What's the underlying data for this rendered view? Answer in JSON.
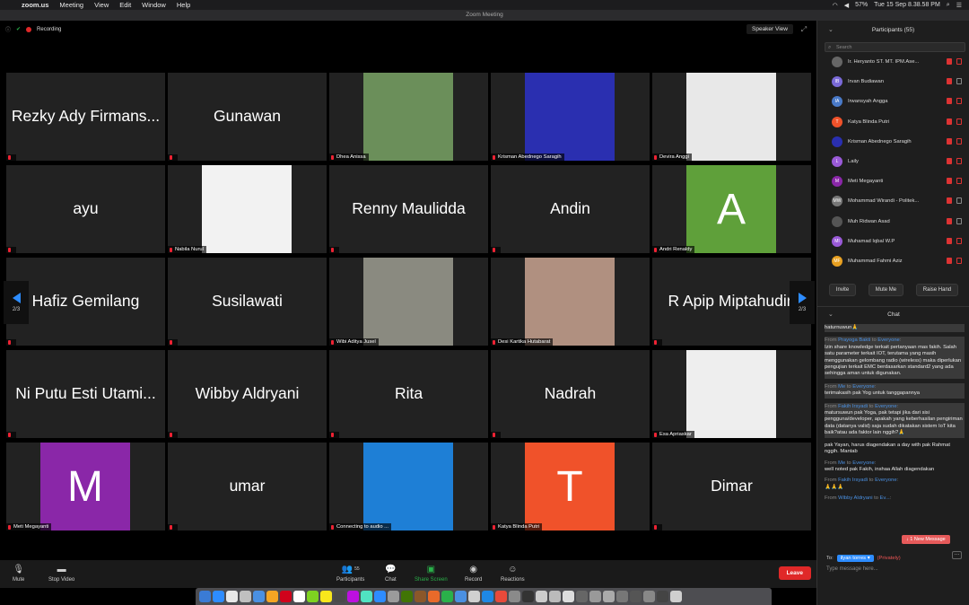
{
  "menubar": {
    "apple": "",
    "app": "zoom.us",
    "items": [
      "Meeting",
      "View",
      "Edit",
      "Window",
      "Help"
    ],
    "battery": "57%",
    "datetime": "Tue 15 Sep 8.38.58 PM"
  },
  "window": {
    "title": "Zoom Meeting"
  },
  "meeting": {
    "recording_label": "Recording",
    "speaker_view": "Speaker View",
    "page_left": "2/3",
    "page_right": "2/3"
  },
  "tiles": [
    {
      "name": "Rezky Ady Firmans...",
      "label": "",
      "kind": "name"
    },
    {
      "name": "Gunawan",
      "label": "",
      "kind": "name"
    },
    {
      "name": "",
      "label": "Dhea Anissa",
      "kind": "photo",
      "color": "#6b8f5a"
    },
    {
      "name": "",
      "label": "Krisman Abednego Saragih",
      "kind": "photo",
      "color": "#2a2fb0"
    },
    {
      "name": "",
      "label": "Devira Anggi",
      "kind": "photo",
      "color": "#e8e8e8"
    },
    {
      "name": "ayu",
      "label": "",
      "kind": "name"
    },
    {
      "name": "",
      "label": "Nabila Nurul",
      "kind": "photo",
      "color": "#f2f2f2"
    },
    {
      "name": "Renny Maulidda",
      "label": "",
      "kind": "name"
    },
    {
      "name": "Andin",
      "label": "",
      "kind": "name"
    },
    {
      "name": "A",
      "label": "Andri Renaldy",
      "kind": "avatar",
      "color": "#5fa03a"
    },
    {
      "name": "Hafiz Gemilang",
      "label": "",
      "kind": "name"
    },
    {
      "name": "Susilawati",
      "label": "",
      "kind": "name"
    },
    {
      "name": "",
      "label": "Wibi Aditya Jusel",
      "kind": "photo",
      "color": "#8a8a80"
    },
    {
      "name": "",
      "label": "Desi Kartika Hutabarat",
      "kind": "photo",
      "color": "#b09080"
    },
    {
      "name": "R Apip Miptahudin",
      "label": "",
      "kind": "name"
    },
    {
      "name": "Ni Putu Esti Utami...",
      "label": "",
      "kind": "name"
    },
    {
      "name": "Wibby Aldryani",
      "label": "",
      "kind": "name"
    },
    {
      "name": "Rita",
      "label": "",
      "kind": "name"
    },
    {
      "name": "Nadrah",
      "label": "",
      "kind": "name"
    },
    {
      "name": "",
      "label": "Esa Apriaskar",
      "kind": "photo",
      "color": "#eeeeee"
    },
    {
      "name": "M",
      "label": "Meti Megayanti",
      "kind": "avatar",
      "color": "#8a27a8"
    },
    {
      "name": "umar",
      "label": "",
      "kind": "name"
    },
    {
      "name": "",
      "label": "Connecting to audio ...",
      "kind": "photo",
      "color": "#1e7fd6"
    },
    {
      "name": "T",
      "label": "Katya Blinda Putri",
      "kind": "avatar",
      "color": "#f0522a"
    },
    {
      "name": "Dimar",
      "label": "",
      "kind": "name"
    }
  ],
  "toolbar": {
    "mute": "Mute",
    "stop_video": "Stop Video",
    "participants_count": "55",
    "participants": "Participants",
    "chat": "Chat",
    "share": "Share Screen",
    "record": "Record",
    "reactions": "Reactions",
    "leave": "Leave"
  },
  "panel": {
    "title": "Participants (55)",
    "search_placeholder": "Search",
    "participants": [
      {
        "name": "Ir. Heryanto ST. MT. IPM.Ase...",
        "initials": "",
        "color": "#666666",
        "video": "red"
      },
      {
        "name": "Irvan Budiawan",
        "initials": "IB",
        "color": "#7a6ad8",
        "video": "gray"
      },
      {
        "name": "Irwansyah Angga",
        "initials": "IA",
        "color": "#4a7ac8",
        "video": "red"
      },
      {
        "name": "Katya Blinda Putri",
        "initials": "T",
        "color": "#f0522a",
        "video": "red"
      },
      {
        "name": "Krisman Abednego Saragih",
        "initials": "",
        "color": "#2a2fb0",
        "video": "red"
      },
      {
        "name": "Laily",
        "initials": "L",
        "color": "#9a5ad8",
        "video": "red"
      },
      {
        "name": "Meti Megayanti",
        "initials": "M",
        "color": "#8a27a8",
        "video": "red"
      },
      {
        "name": "Mohammad Wirandi - Politek...",
        "initials": "MW",
        "color": "#777777",
        "video": "gray"
      },
      {
        "name": "Muh Ridwan Asad",
        "initials": "",
        "color": "#555555",
        "video": "gray"
      },
      {
        "name": "Muhamad Iqbal W.P",
        "initials": "MI",
        "color": "#9a5ad8",
        "video": "red"
      },
      {
        "name": "Muhammad Fahmi Aziz",
        "initials": "MF",
        "color": "#e8a020",
        "video": "red"
      }
    ],
    "invite": "Invite",
    "mute_me": "Mute Me",
    "raise_hand": "Raise Hand"
  },
  "chat": {
    "title": "Chat",
    "messages": [
      {
        "from": "",
        "to": "",
        "text": "haturnuwun🙏",
        "highlight": true
      },
      {
        "from": "Prayoga Bakti",
        "to": "Everyone",
        "text": "Izin share knowledge terkait pertanyaan mas fakih. Salah satu parameter terkait IOT, terutama yang masih menggunakan gelombang radio (wireless) maka diperlukan pengujian terkait EMC berdasarkan standard2 yang ada sehingga aman untuk digunakan.",
        "highlight": true
      },
      {
        "from": "Me",
        "to": "Everyone",
        "text": "terimakasih pak Yog untuk tanggapannya",
        "highlight": true
      },
      {
        "from": "Fakih Irsyadi",
        "to": "Everyone",
        "text": "matursuwun pak Yoga, pak tetapi jika dari sisi pengguna/developer, apakah yang keberhasilan pengiriman data (datanya valid) saja sudah dikatakan sistem IoT kita baik?atau ada faktor lain nggih?🙏",
        "highlight": true
      },
      {
        "from": "",
        "to": "",
        "text": "pak Yayan, harus diagendakan a day with pak Rahmat nggih. Mantab",
        "highlight": false
      },
      {
        "from": "Me",
        "to": "Everyone",
        "text": "well noted pak Fakih, inshaa Allah diagendakan",
        "highlight": false
      },
      {
        "from": "Fakih Irsyadi",
        "to": "Everyone",
        "text": "🙏🙏🙏",
        "highlight": false
      },
      {
        "from": "Wibby Aldryani",
        "to": "Ev...",
        "text": "",
        "highlight": false
      }
    ],
    "new_message": "↓ 1 New Message",
    "to_label": "To:",
    "to_value": "ilyan torres ▾",
    "privately": "(Privately)",
    "input_placeholder": "Type message here..."
  }
}
